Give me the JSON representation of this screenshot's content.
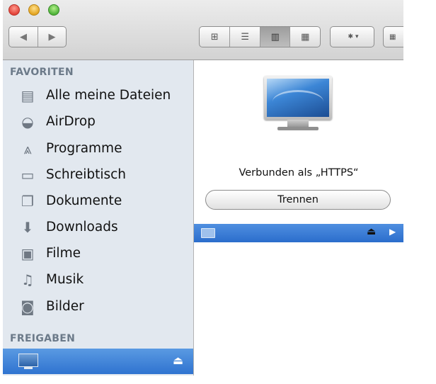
{
  "window": {
    "toolbar": {
      "nav": {
        "back_icon": "chevron-left",
        "forward_icon": "chevron-right"
      },
      "view_modes": [
        {
          "name": "icon-view",
          "glyph": "⊞",
          "active": false
        },
        {
          "name": "list-view",
          "glyph": "☰",
          "active": false
        },
        {
          "name": "column-view",
          "glyph": "▥",
          "active": true
        },
        {
          "name": "coverflow-view",
          "glyph": "▦",
          "active": false
        }
      ],
      "action_glyph": "✱",
      "action_caret": "▾"
    }
  },
  "sidebar": {
    "favorites_title": "FAVORITEN",
    "items": [
      {
        "label": "Alle meine Dateien",
        "icon": "all-files-icon",
        "glyph": "▤"
      },
      {
        "label": "AirDrop",
        "icon": "airdrop-icon",
        "glyph": "◒"
      },
      {
        "label": "Programme",
        "icon": "applications-icon",
        "glyph": "⩓"
      },
      {
        "label": "Schreibtisch",
        "icon": "desktop-icon",
        "glyph": "▭"
      },
      {
        "label": "Dokumente",
        "icon": "documents-icon",
        "glyph": "❐"
      },
      {
        "label": "Downloads",
        "icon": "downloads-icon",
        "glyph": "⬇"
      },
      {
        "label": "Filme",
        "icon": "movies-icon",
        "glyph": "▣"
      },
      {
        "label": "Musik",
        "icon": "music-icon",
        "glyph": "♫"
      },
      {
        "label": "Bilder",
        "icon": "pictures-icon",
        "glyph": "◙"
      }
    ],
    "shared_title": "FREIGABEN",
    "shared_eject": "⏏"
  },
  "main": {
    "connected_text": "Verbunden als „HTTPS“",
    "disconnect_label": "Trennen",
    "eject_glyph": "⏏",
    "play_glyph": "▶"
  },
  "colors": {
    "selection": "#2f73d0",
    "sidebar_bg": "#e2e8ef",
    "section_title": "#6c7a89"
  }
}
